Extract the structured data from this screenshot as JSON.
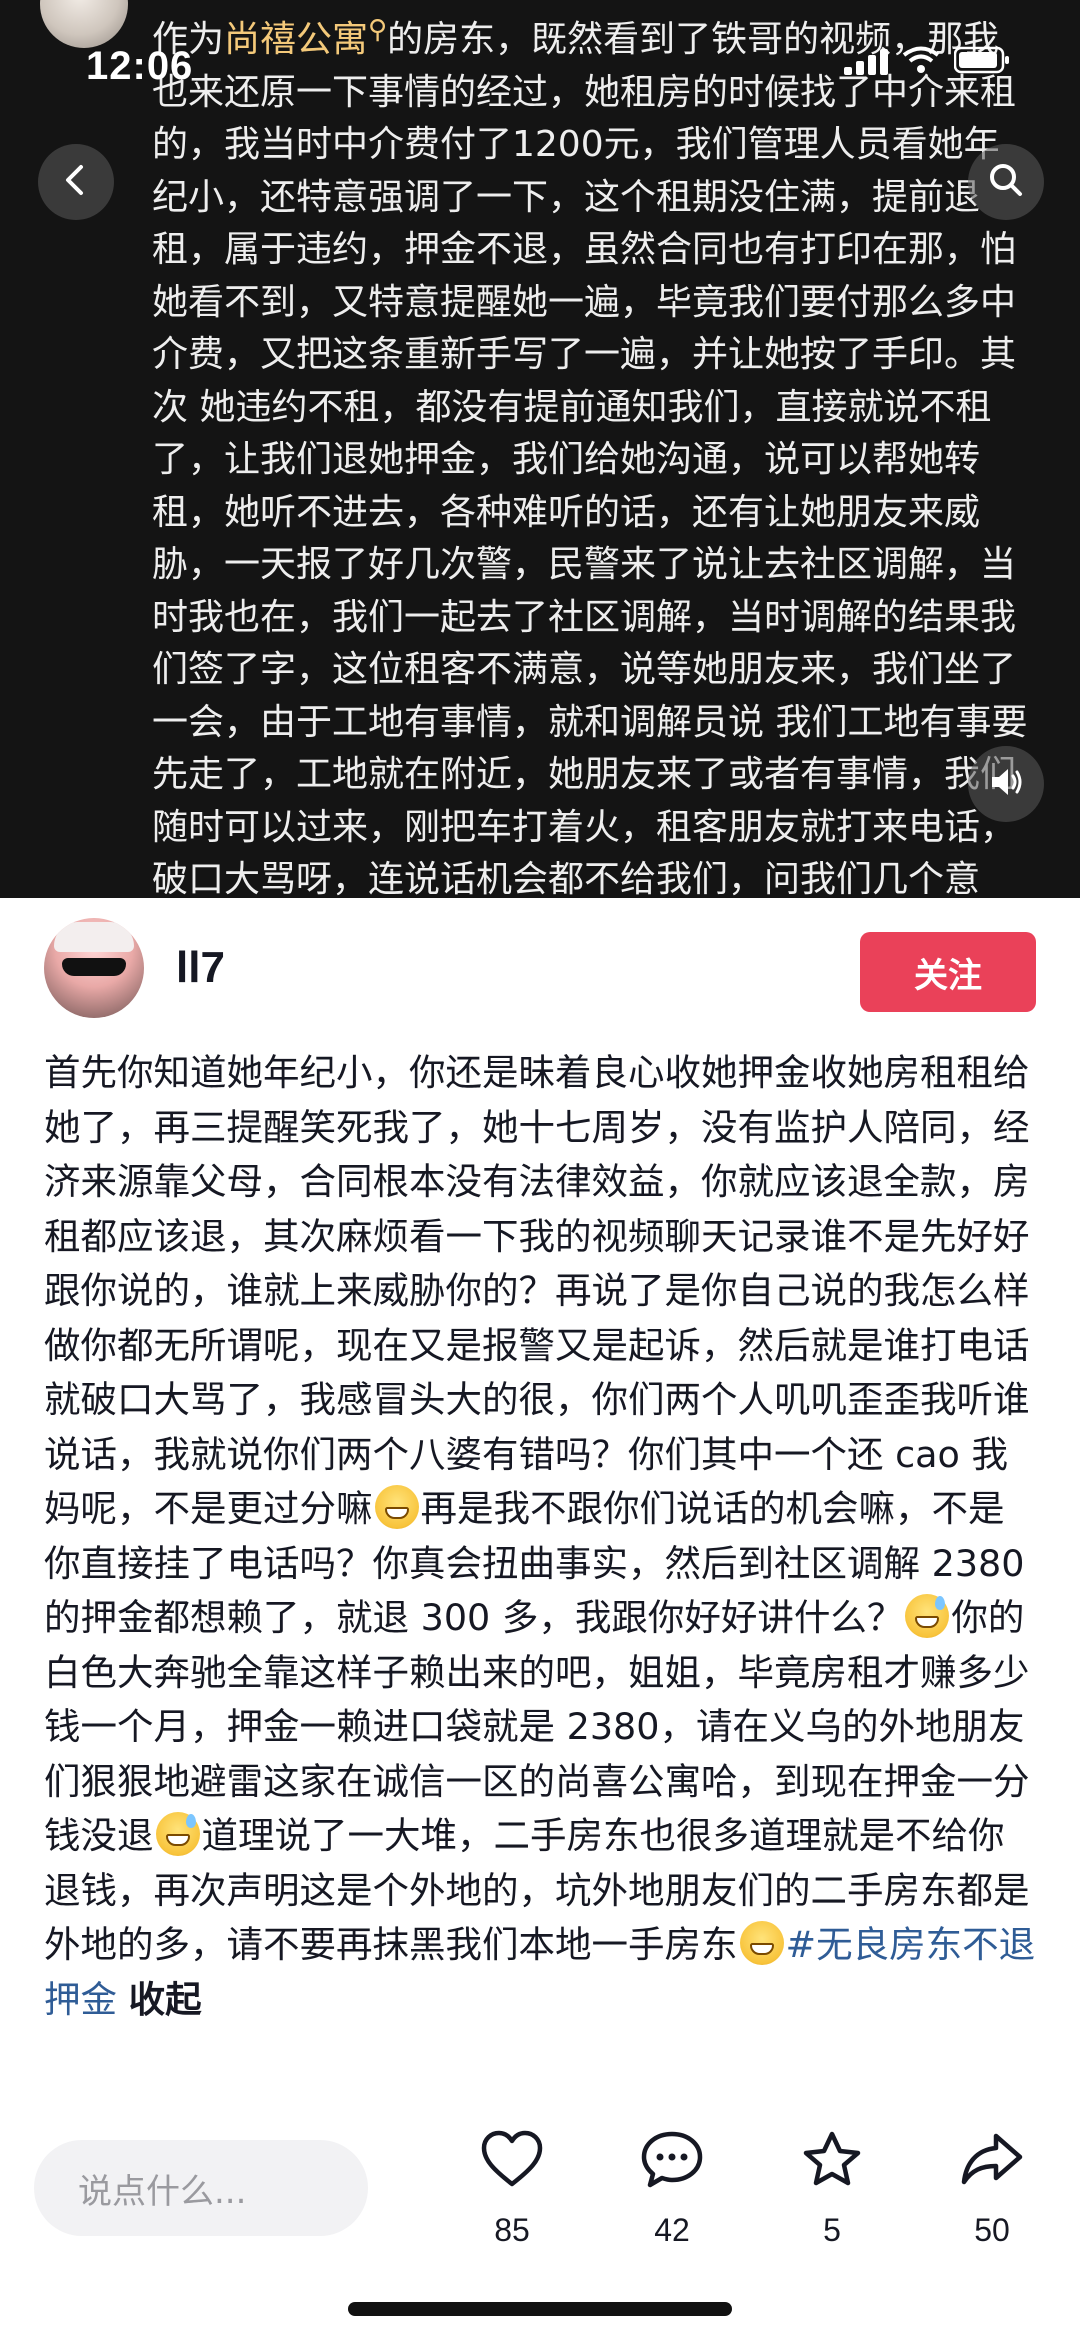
{
  "status_bar": {
    "time": "12:06"
  },
  "media_comment": {
    "prefix": "作为",
    "mention": "尚禧公寓",
    "text": "的房东，既然看到了铁哥的视频，那我也来还原一下事情的经过，她租房的时候找了中介来租的，我当时中介费付了1200元，我们管理人员看她年纪小，还特意强调了一下，这个租期没住满，提前退租，属于违约，押金不退，虽然合同也有打印在那，怕她看不到，又特意提醒她一遍，毕竟我们要付那么多中介费，又把这条重新手写了一遍，并让她按了手印。其次 她违约不租，都没有提前通知我们，直接就说不租了，让我们退她押金，我们给她沟通，说可以帮她转租，她听不进去，各种难听的话，还有让她朋友来威胁，一天报了好几次警，民警来了说让去社区调解，当时我也在，我们一起去了社区调解，当时调解的结果我们签了字，这位租客不满意，说等她朋友来，我们坐了一会，由于工地有事情，就和调解员说 我们工地有事要先走了，工地就在附近，她朋友来了或者有事情，我们随时可以过来，刚把车打着火，租客朋友就打来电话，破口大骂呀，连说话机会都不给我们，问我们几个意思，说她一来我们就走，我们怎么解释都不听，后面我们就直接又回去了社"
  },
  "user": {
    "name": "ll7",
    "follow_label": "关注"
  },
  "comment": {
    "part1": "首先你知道她年纪小，你还是昧着良心收她押金收她房租租给她了，再三提醒笑死我了，她十七周岁，没有监护人陪同，经济来源靠父母，合同根本没有法律效益，你就应该退全款，房租都应该退，其次麻烦看一下我的视频聊天记录谁不是先好好跟你说的，谁就上来威胁你的？再说了是你自己说的我怎么样做你都无所谓呢，现在又是报警又是起诉，然后就是谁打电话就破口大骂了，我感冒头大的很，你们两个人叽叽歪歪我听谁说话，我就说你们两个八婆有错吗？你们其中一个还 cao 我妈呢，不是更过分嘛",
    "part2": "再是我不跟你们说话的机会嘛，不是你直接挂了电话吗？你真会扭曲事实，然后到社区调解 2380 的押金都想赖了，就退 300 多，我跟你好好讲什么？",
    "part3": "你的白色大奔驰全靠这样子赖出来的吧，姐姐，毕竟房租才赚多少钱一个月，押金一赖进口袋就是 2380，请在义乌的外地朋友们狠狠地避雷这家在诚信一区的尚喜公寓哈，到现在押金一分钱没退",
    "part4": "道理说了一大堆，二手房东也很多道理就是不给你退钱，再次声明这是个外地的，坑外地朋友们的二手房东都是外地的多，请不要再抹黑我们本地一手房东",
    "hashtag": "#无良房东不退押金",
    "collapse_label": "收起"
  },
  "bottom_bar": {
    "input_placeholder": "说点什么...",
    "likes": "85",
    "comments": "42",
    "favorites": "5",
    "shares": "50"
  },
  "icons": [
    "back-icon",
    "search-icon",
    "volume-icon",
    "heart-icon",
    "comment-bubble-icon",
    "star-icon",
    "share-icon"
  ],
  "colors": {
    "follow": "#ea4159",
    "hashtag": "#2f5c96",
    "mention": "#f4c97a"
  }
}
